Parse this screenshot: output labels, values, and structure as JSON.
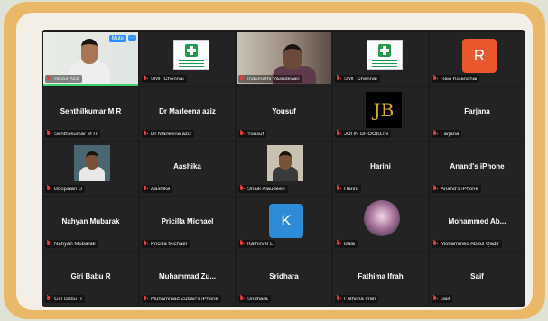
{
  "mute_label": "Mute",
  "more_label": "···",
  "colors": {
    "frame": "#e9b967",
    "screen": "#1c1c1c",
    "speaking": "#3fd26b",
    "muted_icon": "#e04141"
  },
  "tiles": [
    {
      "center_name": "",
      "label": "Abdul Aziz",
      "kind": "photo-man",
      "speaking": true
    },
    {
      "center_name": "",
      "label": "SMF Chennai",
      "kind": "smf-logo"
    },
    {
      "center_name": "",
      "label": "Indumathi Vasudevan",
      "kind": "photo-woman"
    },
    {
      "center_name": "",
      "label": "SMF Chennai",
      "kind": "smf-logo"
    },
    {
      "center_name": "",
      "label": "Ravi Kolandhai",
      "kind": "avatar",
      "letter": "R",
      "avatar_color": "#e8582c"
    },
    {
      "center_name": "Senthilkumar M R",
      "label": "Senthilkumar M R"
    },
    {
      "center_name": "Dr Marleena aziz",
      "label": "Dr Marleena aziz"
    },
    {
      "center_name": "Yousuf",
      "label": "Yousuf"
    },
    {
      "center_name": "",
      "label": "JOHN BROOKLIN",
      "kind": "jb-logo",
      "letter": "JB"
    },
    {
      "center_name": "Farjana",
      "label": "Farjana"
    },
    {
      "center_name": "",
      "label": "Boopalan S",
      "kind": "photo-small"
    },
    {
      "center_name": "Aashika",
      "label": "Aashika"
    },
    {
      "center_name": "",
      "label": "Shaik Alaudeen",
      "kind": "photo-small2"
    },
    {
      "center_name": "Harini",
      "label": "Harini"
    },
    {
      "center_name": "Anand's iPhone",
      "label": "Anand's iPhone"
    },
    {
      "center_name": "Nahyan Mubarak",
      "label": "Nahyan Mubarak"
    },
    {
      "center_name": "Pricilla Michael",
      "label": "Pricilla Michael"
    },
    {
      "center_name": "",
      "label": "Kathirvel L",
      "kind": "avatar",
      "letter": "K",
      "avatar_color": "#2d8cd8"
    },
    {
      "center_name": "",
      "label": "Bala",
      "kind": "photo-anime"
    },
    {
      "center_name": "Mohammed Ab...",
      "label": "Mohammed Abdul Qadir"
    },
    {
      "center_name": "Giri Babu R",
      "label": "Giri Babu R"
    },
    {
      "center_name": "Muhammad Zu...",
      "label": "Muhammad Zubair's iPhone"
    },
    {
      "center_name": "Sridhara",
      "label": "Sridhara"
    },
    {
      "center_name": "Fathima Ifrah",
      "label": "Fathima Ifrah"
    },
    {
      "center_name": "Saif",
      "label": "Saif"
    }
  ]
}
